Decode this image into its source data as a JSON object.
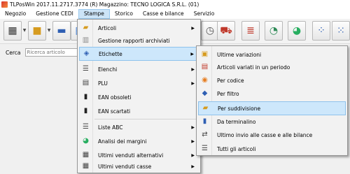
{
  "window": {
    "title": "TLPosWin 2017.11.2717.3774 (R)     Magazzino: TECNO LOGICA S.R.L. (01)"
  },
  "menubar": {
    "items": [
      {
        "label": "Negozio"
      },
      {
        "label": "Gestione CEDI"
      },
      {
        "label": "Stampe"
      },
      {
        "label": "Storico"
      },
      {
        "label": "Casse e bilance"
      },
      {
        "label": "Servizio"
      }
    ]
  },
  "search": {
    "label": "Cerca",
    "placeholder": "Ricerca articolo"
  },
  "stampe_menu": {
    "items": [
      {
        "label": "Articoli",
        "arrow": "▶"
      },
      {
        "label": "Gestione rapporti archiviati"
      },
      {
        "label": "Etichette",
        "arrow": "▶"
      },
      {
        "label": "Elenchi",
        "arrow": "▶"
      },
      {
        "label": "PLU",
        "arrow": "▶"
      },
      {
        "label": "EAN obsoleti"
      },
      {
        "label": "EAN scartati"
      },
      {
        "label": "Liste ABC",
        "arrow": "▶"
      },
      {
        "label": "Analisi dei margini",
        "arrow": "▶"
      },
      {
        "label": "Ultimi venduti alternativi",
        "arrow": "▶"
      },
      {
        "label": "Ultimi venduti casse",
        "arrow": "▶"
      }
    ]
  },
  "etichette_menu": {
    "items": [
      {
        "label": "Ultime variazioni"
      },
      {
        "label": "Articoli variati in un periodo"
      },
      {
        "label": "Per codice"
      },
      {
        "label": "Per filtro"
      },
      {
        "label": "Per suddivisione"
      },
      {
        "label": "Da terminalino"
      },
      {
        "label": "Ultimo invio alle casse e alle bilance"
      },
      {
        "label": "Tutti gli articoli"
      }
    ]
  },
  "colors": {
    "highlight": "#cde7fb",
    "highlight_border": "#8ec2ec"
  }
}
